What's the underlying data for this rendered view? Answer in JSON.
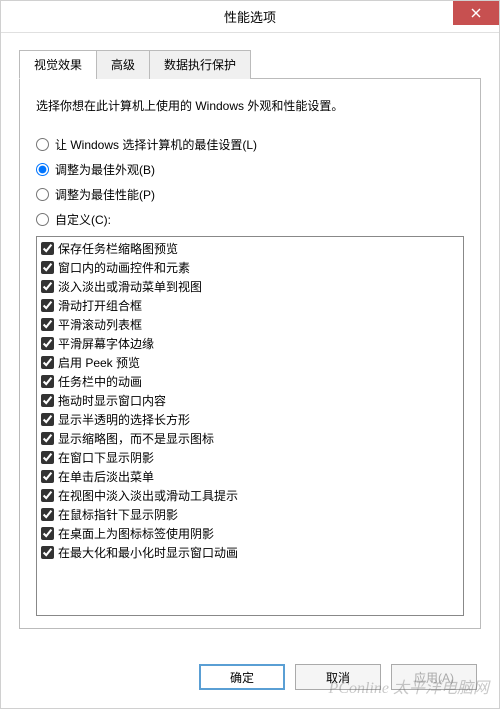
{
  "window": {
    "title": "性能选项"
  },
  "tabs": {
    "visual": "视觉效果",
    "advanced": "高级",
    "dep": "数据执行保护"
  },
  "description": "选择你想在此计算机上使用的 Windows 外观和性能设置。",
  "radios": {
    "auto": "让 Windows 选择计算机的最佳设置(L)",
    "best_appearance": "调整为最佳外观(B)",
    "best_performance": "调整为最佳性能(P)",
    "custom": "自定义(C):"
  },
  "checks": [
    "保存任务栏缩略图预览",
    "窗口内的动画控件和元素",
    "淡入淡出或滑动菜单到视图",
    "滑动打开组合框",
    "平滑滚动列表框",
    "平滑屏幕字体边缘",
    "启用 Peek 预览",
    "任务栏中的动画",
    "拖动时显示窗口内容",
    "显示半透明的选择长方形",
    "显示缩略图，而不是显示图标",
    "在窗口下显示阴影",
    "在单击后淡出菜单",
    "在视图中淡入淡出或滑动工具提示",
    "在鼠标指针下显示阴影",
    "在桌面上为图标标签使用阴影",
    "在最大化和最小化时显示窗口动画"
  ],
  "buttons": {
    "ok": "确定",
    "cancel": "取消",
    "apply": "应用(A)"
  },
  "watermark": "PConline 太平洋电脑网"
}
